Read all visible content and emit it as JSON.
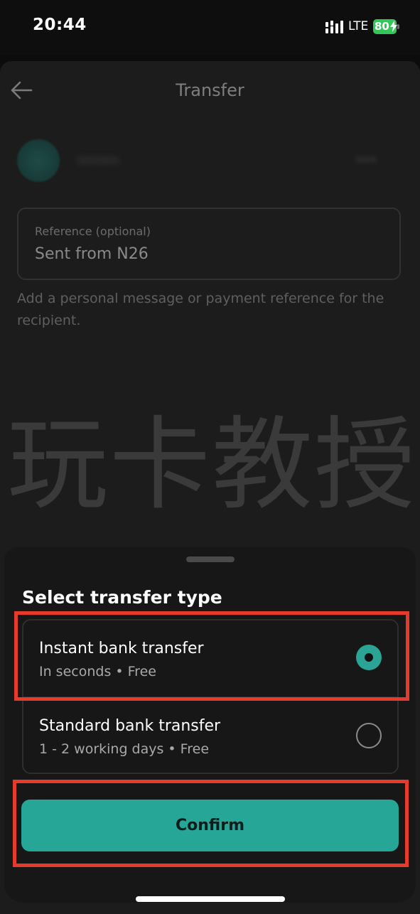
{
  "status_bar": {
    "time": "20:44",
    "network": "LTE",
    "battery_level": "80",
    "battery_color": "#33c759"
  },
  "header": {
    "title": "Transfer",
    "back_icon": "arrow-left-icon"
  },
  "recipient": {
    "name_blurred": "•••••",
    "amount_blurred": "•••"
  },
  "reference": {
    "label": "Reference (optional)",
    "value": "Sent from N26",
    "hint": "Add a personal message or payment reference for the recipient."
  },
  "watermark": "玩卡教授",
  "sheet": {
    "title": "Select transfer type",
    "options": [
      {
        "title": "Instant bank transfer",
        "subtitle": "In seconds • Free",
        "selected": true
      },
      {
        "title": "Standard bank transfer",
        "subtitle": "1 - 2 working days • Free",
        "selected": false
      }
    ],
    "confirm_label": "Confirm",
    "accent_color": "#26a697"
  },
  "annotations": {
    "highlight_color": "#e53b2c"
  }
}
